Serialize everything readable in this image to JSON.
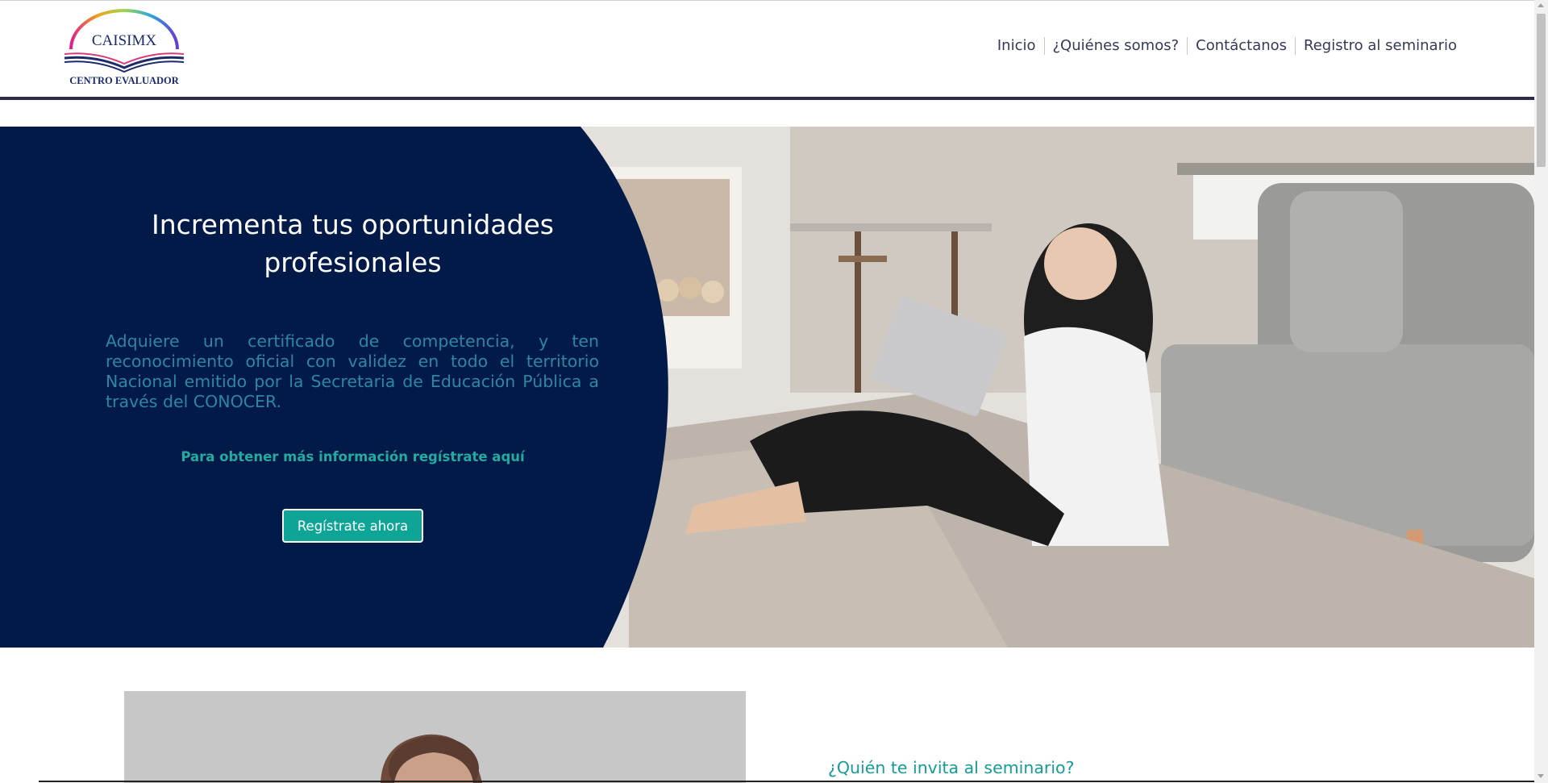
{
  "logo": {
    "name": "CAISIMX",
    "subtitle": "CENTRO EVALUADOR"
  },
  "nav": {
    "items": [
      {
        "label": "Inicio"
      },
      {
        "label": "¿Quiénes somos?"
      },
      {
        "label": "Contáctanos"
      },
      {
        "label": "Registro al seminario"
      }
    ]
  },
  "hero": {
    "title": "Incrementa tus oportunidades profesionales",
    "text": "Adquiere un certificado de competencia, y ten reconocimiento oficial con validez en todo el territorio Nacional emitido por la Secretaria de Educación Pública a través del CONOCER.",
    "cta_text": "Para obtener más información regístrate aquí",
    "button_label": "Regístrate ahora"
  },
  "section": {
    "invite_heading": "¿Quién te invita al seminario?"
  },
  "colors": {
    "hero_panel": "#021a48",
    "accent_teal": "#0fa596",
    "header_rule": "#2b2c47",
    "nav_text": "#343a55"
  },
  "icons": [
    "open-book-logo-icon",
    "rainbow-arc-icon",
    "scroll-up-arrow-icon",
    "scroll-down-arrow-icon"
  ]
}
